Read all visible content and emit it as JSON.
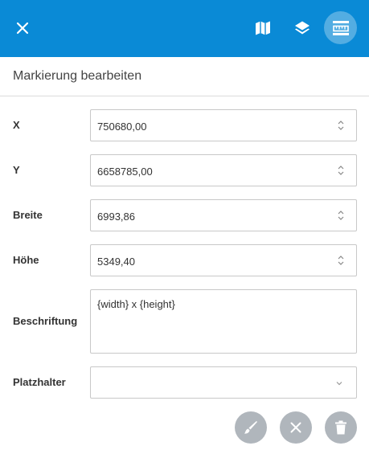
{
  "colors": {
    "header": "#0a8ad6",
    "action_button": "#b0b6bc"
  },
  "icons": {
    "close": "close-icon",
    "map": "map-icon",
    "layers": "layers-icon",
    "measure": "ruler-icon",
    "edit": "brush-icon",
    "cancel": "close-icon",
    "delete": "trash-icon"
  },
  "panel": {
    "title": "Markierung bearbeiten"
  },
  "fields": {
    "x": {
      "label": "X",
      "value": "750680,00"
    },
    "y": {
      "label": "Y",
      "value": "6658785,00"
    },
    "breite": {
      "label": "Breite",
      "value": "6993,86"
    },
    "hoehe": {
      "label": "Höhe",
      "value": "5349,40"
    },
    "beschriftung": {
      "label": "Beschriftung",
      "value": "{width} x {height}"
    },
    "platzhalter": {
      "label": "Platzhalter",
      "value": ""
    }
  }
}
